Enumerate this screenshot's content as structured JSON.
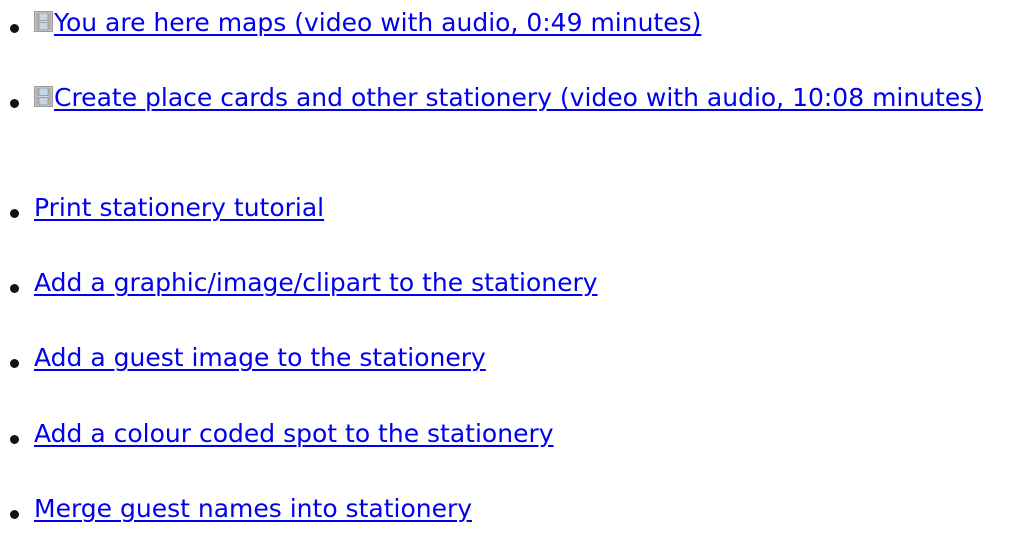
{
  "colors": {
    "link": "#0000ee",
    "bullet": "#111111",
    "background": "#ffffff",
    "film_icon_frame": "#9a9a9a",
    "film_icon_cell": "#c8d5e8"
  },
  "items": [
    {
      "label": "You are here maps (video with audio, 0:49 minutes)",
      "icon": "film-icon"
    },
    {
      "label": "Create place cards and other stationery (video with audio, 10:08 minutes)",
      "icon": "film-icon"
    },
    {
      "label": "Print stationery tutorial",
      "icon": ""
    },
    {
      "label": "Add a graphic/image/clipart to the stationery",
      "icon": ""
    },
    {
      "label": "Add a guest image to the stationery",
      "icon": ""
    },
    {
      "label": "Add a colour coded spot to the stationery",
      "icon": ""
    },
    {
      "label": "Merge guest names into stationery",
      "icon": ""
    }
  ]
}
